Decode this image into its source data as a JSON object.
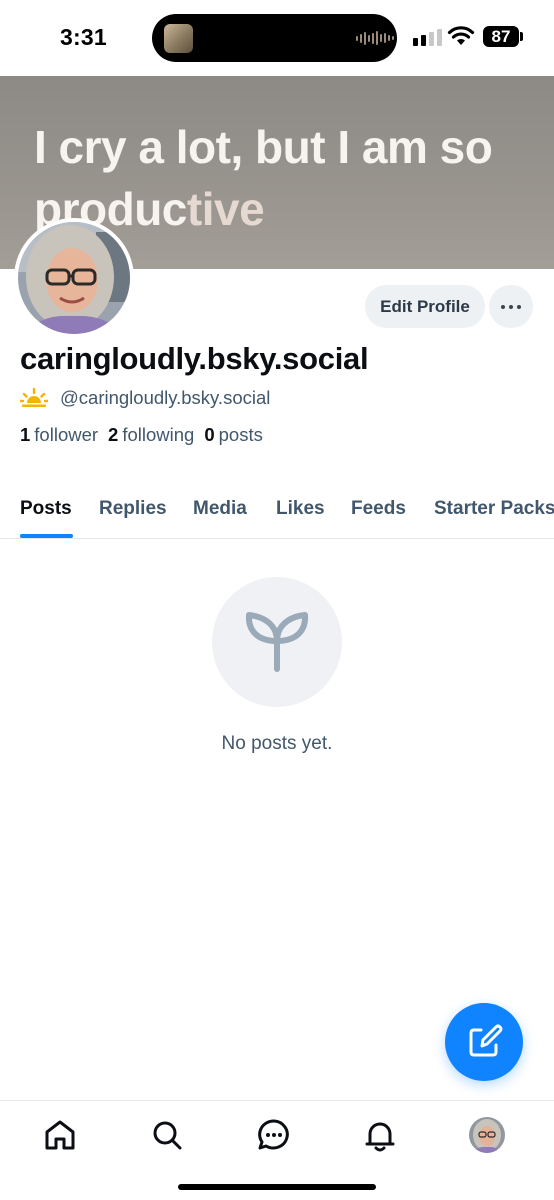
{
  "status_bar": {
    "time": "3:31",
    "battery": "87"
  },
  "banner": {
    "text_line1": "I cry a lot, but I am so",
    "text_line2_a": "produc",
    "text_line2_b": "tive"
  },
  "profile": {
    "display_name": "caringloudly.bsky.social",
    "handle": "@caringloudly.bsky.social",
    "followers_count": "1",
    "followers_label": "follower",
    "following_count": "2",
    "following_label": "following",
    "posts_count": "0",
    "posts_label": "posts"
  },
  "actions": {
    "edit_profile": "Edit Profile"
  },
  "tabs": [
    {
      "label": "Posts",
      "active": true
    },
    {
      "label": "Replies",
      "active": false
    },
    {
      "label": "Media",
      "active": false
    },
    {
      "label": "Likes",
      "active": false
    },
    {
      "label": "Feeds",
      "active": false
    },
    {
      "label": "Starter Packs",
      "active": false
    }
  ],
  "empty_state": {
    "message": "No posts yet.",
    "icon": "sprout-icon"
  },
  "bottom_nav": {
    "items": [
      "home-icon",
      "search-icon",
      "chat-icon",
      "bell-icon",
      "profile-avatar"
    ]
  },
  "colors": {
    "accent": "#1083fe",
    "muted_text": "#42576c",
    "chip_bg": "#eef1f4",
    "sun": "#f5b400"
  }
}
